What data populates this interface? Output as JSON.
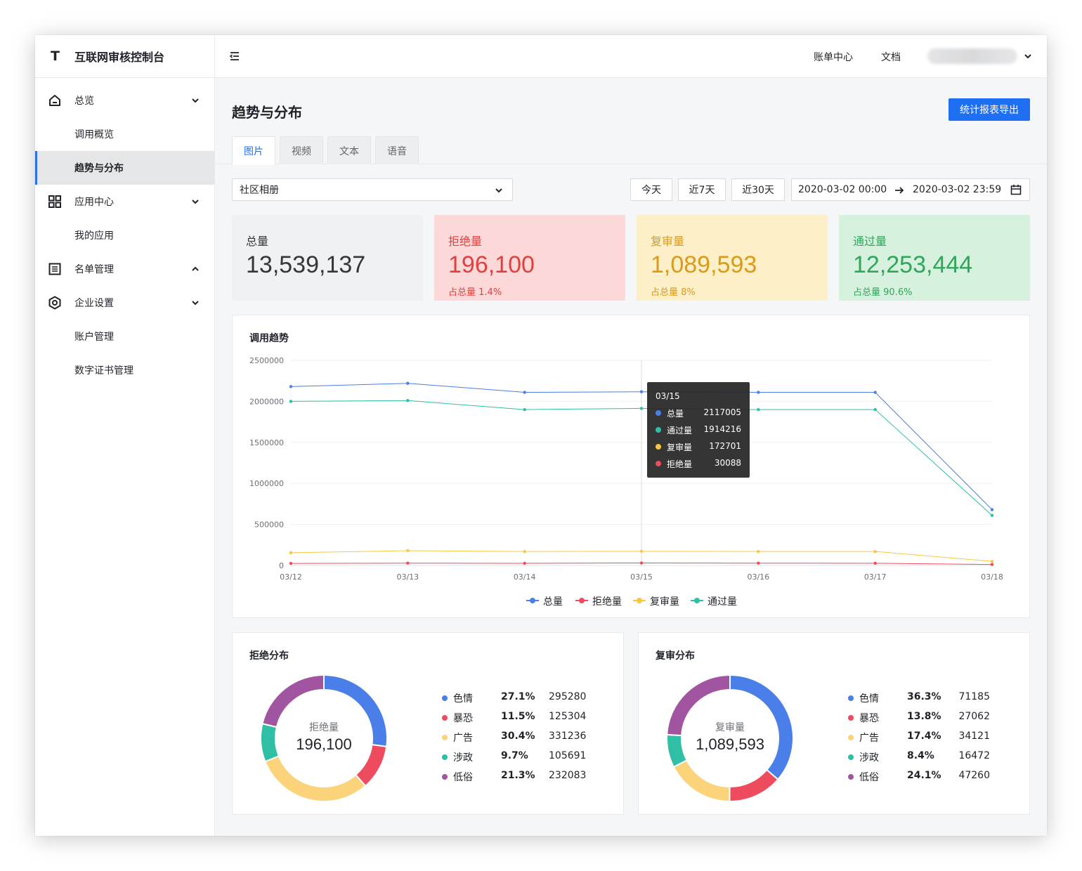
{
  "app": {
    "logo": "T",
    "title": "互联网审核控制台"
  },
  "sidebar": {
    "items": [
      {
        "label": "总览",
        "type": "group",
        "icon": "home-icon",
        "chevron": "down"
      },
      {
        "label": "调用概览",
        "type": "sub"
      },
      {
        "label": "趋势与分布",
        "type": "sub",
        "active": true
      },
      {
        "label": "应用中心",
        "type": "group",
        "icon": "grid-icon",
        "chevron": "down"
      },
      {
        "label": "我的应用",
        "type": "sub"
      },
      {
        "label": "名单管理",
        "type": "group",
        "icon": "list-icon",
        "chevron": "up"
      },
      {
        "label": "企业设置",
        "type": "group",
        "icon": "settings-icon",
        "chevron": "down"
      },
      {
        "label": "账户管理",
        "type": "sub"
      },
      {
        "label": "数字证书管理",
        "type": "sub"
      }
    ]
  },
  "header": {
    "billing": "账单中心",
    "docs": "文档"
  },
  "page": {
    "title": "趋势与分布",
    "export_label": "统计报表导出",
    "tabs": [
      "图片",
      "视频",
      "文本",
      "语音"
    ],
    "active_tab": 0
  },
  "filters": {
    "app_select": "社区相册",
    "quick": [
      "今天",
      "近7天",
      "近30天"
    ],
    "date_start": "2020-03-02 00:00",
    "date_end": "2020-03-02 23:59"
  },
  "stats": [
    {
      "label": "总量",
      "value": "13,539,137",
      "sub_label": "",
      "sub_value": "",
      "bg": "#f0f1f2",
      "color": "#34373c"
    },
    {
      "label": "拒绝量",
      "value": "196,100",
      "sub_label": "占总量",
      "sub_value": "1.4%",
      "bg": "#fdd8d8",
      "color": "#e0413f"
    },
    {
      "label": "复审量",
      "value": "1,089,593",
      "sub_label": "占总量",
      "sub_value": "8%",
      "bg": "#fdefc8",
      "color": "#d99b18"
    },
    {
      "label": "通过量",
      "value": "12,253,444",
      "sub_label": "占总量",
      "sub_value": "90.6%",
      "bg": "#d6f2df",
      "color": "#2fa65a"
    }
  ],
  "trend": {
    "title": "调用趋势",
    "tooltip": {
      "date": "03/15",
      "rows": [
        {
          "name": "总量",
          "value": "2117005",
          "color": "#4a7ee8"
        },
        {
          "name": "通过量",
          "value": "1914216",
          "color": "#2ebfa5"
        },
        {
          "name": "复审量",
          "value": "172701",
          "color": "#f8c740"
        },
        {
          "name": "拒绝量",
          "value": "30088",
          "color": "#ef4b5e"
        }
      ]
    }
  },
  "chart_data": [
    {
      "type": "line",
      "title": "调用趋势",
      "x": [
        "03/12",
        "03/13",
        "03/14",
        "03/15",
        "03/16",
        "03/17",
        "03/18"
      ],
      "ylim": [
        0,
        2500000
      ],
      "yticks": [
        "2500000",
        "2000000",
        "1500000",
        "1000000",
        "500000",
        "0"
      ],
      "grid": true,
      "legend_position": "bottom",
      "series": [
        {
          "name": "总量",
          "color": "#4a7ee8",
          "values": [
            2180000,
            2220000,
            2110000,
            2117005,
            2110000,
            2110000,
            680000
          ]
        },
        {
          "name": "拒绝量",
          "color": "#ef4b5e",
          "values": [
            25000,
            28000,
            26000,
            30088,
            28000,
            27000,
            12000
          ]
        },
        {
          "name": "复审量",
          "color": "#f8c740",
          "values": [
            155000,
            180000,
            170000,
            172701,
            170000,
            170000,
            50000
          ]
        },
        {
          "name": "通过量",
          "color": "#2ebfa5",
          "values": [
            2000000,
            2010000,
            1900000,
            1914216,
            1900000,
            1900000,
            610000
          ]
        }
      ]
    },
    {
      "type": "pie",
      "title": "拒绝分布",
      "center_label": "拒绝量",
      "center_value": "196,100",
      "slices": [
        {
          "name": "色情",
          "pct": "27.1%",
          "value": 295280,
          "color": "#4a7ee8"
        },
        {
          "name": "暴恐",
          "pct": "11.5%",
          "value": 125304,
          "color": "#ef4b5e"
        },
        {
          "name": "广告",
          "pct": "30.4%",
          "value": 331236,
          "color": "#fbd37b"
        },
        {
          "name": "涉政",
          "pct": "9.7%",
          "value": 105691,
          "color": "#2ebfa5"
        },
        {
          "name": "低俗",
          "pct": "21.3%",
          "value": 232083,
          "color": "#a155a0"
        }
      ]
    },
    {
      "type": "pie",
      "title": "复审分布",
      "center_label": "复审量",
      "center_value": "1,089,593",
      "slices": [
        {
          "name": "色情",
          "pct": "36.3%",
          "value": 71185,
          "color": "#4a7ee8"
        },
        {
          "name": "暴恐",
          "pct": "13.8%",
          "value": 27062,
          "color": "#ef4b5e"
        },
        {
          "name": "广告",
          "pct": "17.4%",
          "value": 34121,
          "color": "#fbd37b"
        },
        {
          "name": "涉政",
          "pct": "8.4%",
          "value": 16472,
          "color": "#2ebfa5"
        },
        {
          "name": "低俗",
          "pct": "24.1%",
          "value": 47260,
          "color": "#a155a0"
        }
      ]
    }
  ]
}
